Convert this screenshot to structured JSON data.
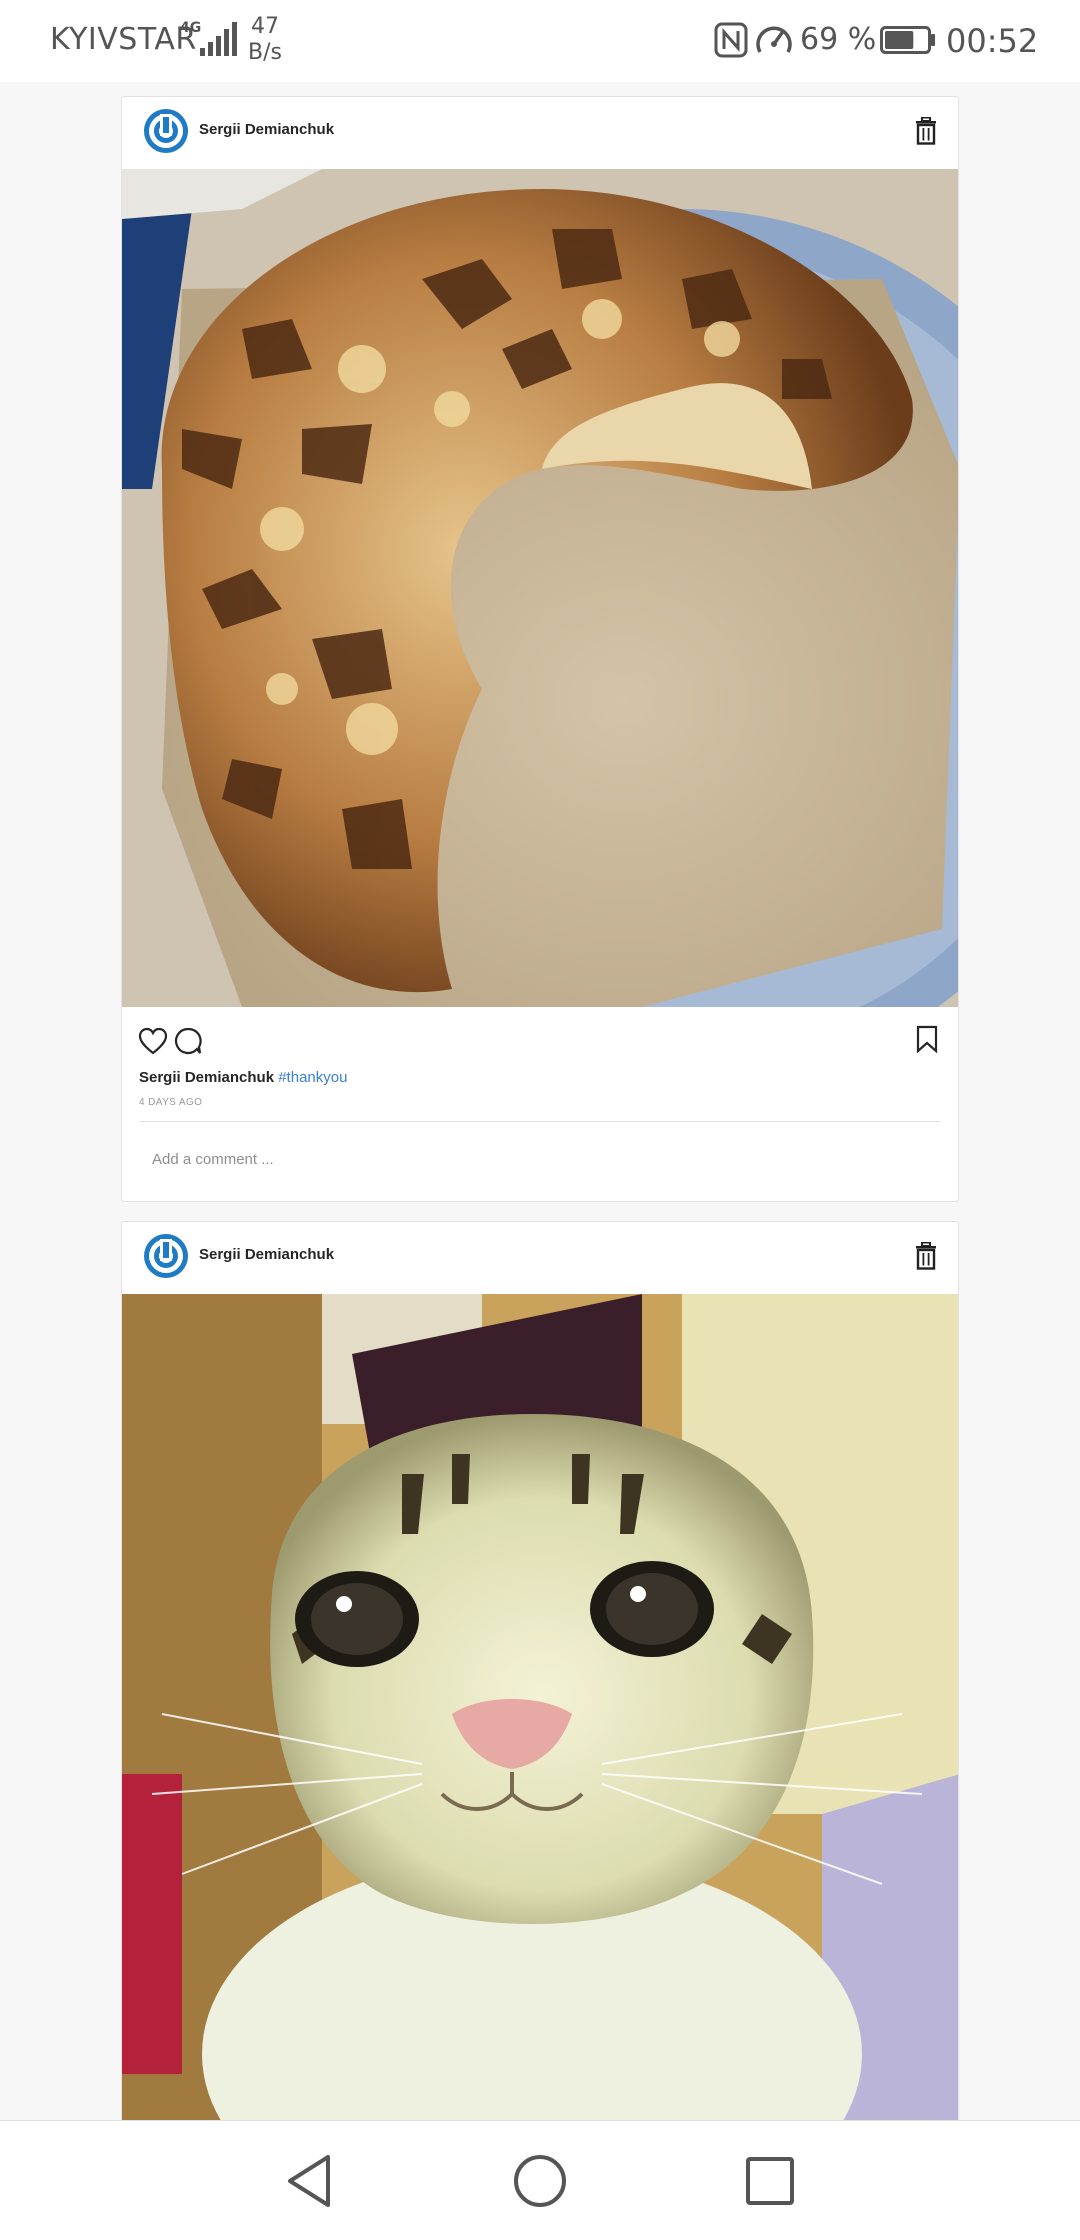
{
  "status_bar": {
    "carrier": "KYIVSTAR",
    "network_type": "4G",
    "speed_value": "47",
    "speed_unit": "B/s",
    "battery_percent": "69 %",
    "battery_level": 0.69,
    "time": "00:52",
    "icons": [
      "signal-icon",
      "nfc-icon",
      "performance-icon",
      "battery-icon"
    ]
  },
  "posts": [
    {
      "username": "Sergii Demianchuk",
      "photo": "apple-cake-photo",
      "caption_user": "Sergii Demianchuk",
      "hashtag": "#thankyou",
      "time_ago": "4 DAYS AGO",
      "comment_placeholder": "Add a comment ..."
    },
    {
      "username": "Sergii Demianchuk",
      "photo": "smiling-cat-photo"
    }
  ],
  "colors": {
    "avatar_blue": "#1f7bc4",
    "hashtag_blue": "#3b7fd3",
    "background": "#f7f7f7"
  }
}
